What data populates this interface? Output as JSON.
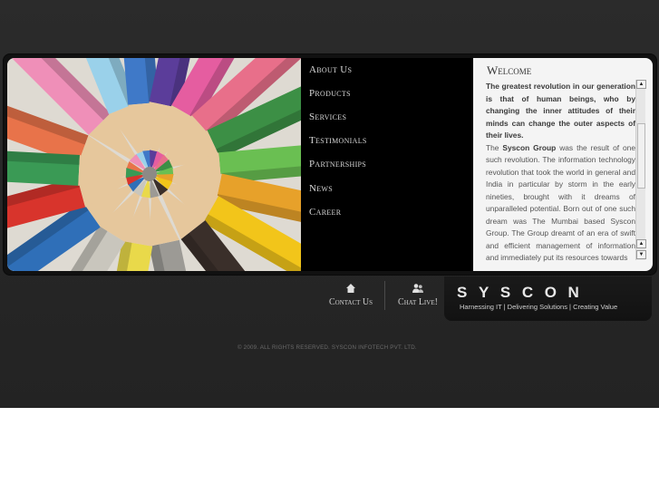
{
  "nav": {
    "items": [
      "About Us",
      "Products",
      "Services",
      "Testimonials",
      "Partnerships",
      "News",
      "Career"
    ]
  },
  "welcome": {
    "title": "Welcome",
    "lead": "The greatest revolution in our generation is that of human beings, who by changing the inner attitudes of their minds can change the outer aspects of their lives.",
    "body_pre": "The ",
    "body_brand": "Syscon Group",
    "body_post": " was the result of one such revolution. The information technology revolution that took the world in general and India in particular by storm in the early nineties, brought with it dreams of unparalleled potential. Born out of one such dream was The Mumbai based Syscon Group. The Group dreamt of an era of swift and efficient management of information and immediately put its resources towards"
  },
  "footer": {
    "contact_label": "Contact Us",
    "chat_label": "Chat Live!",
    "contact_icon": "home-icon",
    "chat_icon": "users-icon",
    "copyright": "© 2009. ALL RIGHTS RESERVED. SYSCON INFOTECH PVT. LTD."
  },
  "logo": {
    "word": "SYSCON",
    "tagline": "Harnessing IT   |   Delivering Solutions   |   Creating Value"
  },
  "colors": {
    "background": "#262626",
    "nav_panel": "#000000",
    "content_panel": "#f4f4f4"
  }
}
